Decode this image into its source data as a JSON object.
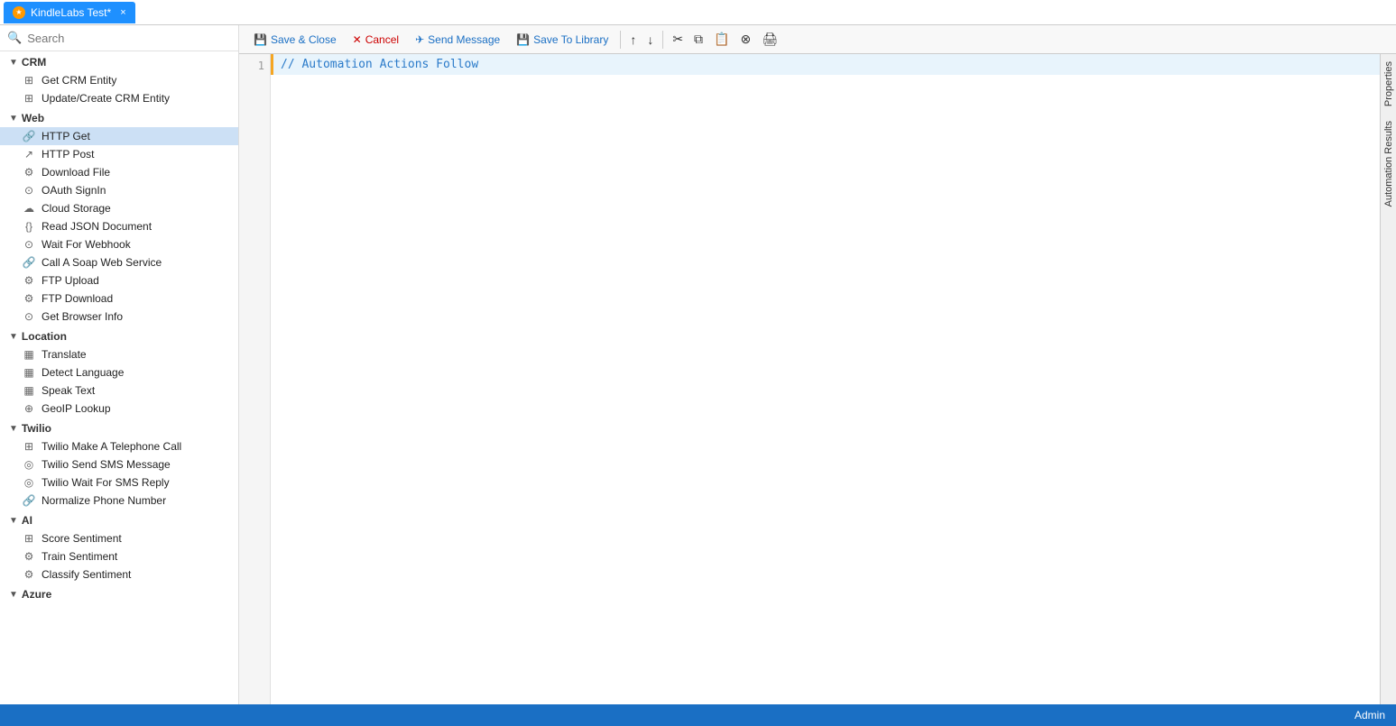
{
  "titleBar": {
    "tabLabel": "KindleLabs Test*",
    "tabIcon": "★",
    "closeLabel": "×"
  },
  "search": {
    "placeholder": "Search"
  },
  "sidebar": {
    "sections": [
      {
        "id": "crm",
        "label": "CRM",
        "items": [
          {
            "id": "get-crm-entity",
            "label": "Get CRM Entity",
            "icon": "⊞"
          },
          {
            "id": "update-create-crm-entity",
            "label": "Update/Create CRM Entity",
            "icon": "⊞"
          }
        ]
      },
      {
        "id": "web",
        "label": "Web",
        "items": [
          {
            "id": "http-get",
            "label": "HTTP Get",
            "icon": "🔗",
            "active": true
          },
          {
            "id": "http-post",
            "label": "HTTP Post",
            "icon": "↗"
          },
          {
            "id": "download-file",
            "label": "Download File",
            "icon": "⚙"
          },
          {
            "id": "oauth-signin",
            "label": "OAuth SignIn",
            "icon": "⊙"
          },
          {
            "id": "cloud-storage",
            "label": "Cloud Storage",
            "icon": "☁"
          },
          {
            "id": "read-json-document",
            "label": "Read JSON Document",
            "icon": "{}"
          },
          {
            "id": "wait-for-webhook",
            "label": "Wait For Webhook",
            "icon": "⊙"
          },
          {
            "id": "call-soap-web-service",
            "label": "Call A Soap Web Service",
            "icon": "🔗"
          },
          {
            "id": "ftp-upload",
            "label": "FTP Upload",
            "icon": "⚙"
          },
          {
            "id": "ftp-download",
            "label": "FTP Download",
            "icon": "⚙"
          },
          {
            "id": "get-browser-info",
            "label": "Get Browser Info",
            "icon": "⊙"
          }
        ]
      },
      {
        "id": "location",
        "label": "Location",
        "items": [
          {
            "id": "translate",
            "label": "Translate",
            "icon": "▦"
          },
          {
            "id": "detect-language",
            "label": "Detect Language",
            "icon": "▦"
          },
          {
            "id": "speak-text",
            "label": "Speak Text",
            "icon": "▦"
          },
          {
            "id": "geoip-lookup",
            "label": "GeoIP Lookup",
            "icon": "⊕"
          }
        ]
      },
      {
        "id": "twilio",
        "label": "Twilio",
        "items": [
          {
            "id": "twilio-call",
            "label": "Twilio Make A Telephone Call",
            "icon": "⊞"
          },
          {
            "id": "twilio-sms",
            "label": "Twilio Send SMS Message",
            "icon": "◎"
          },
          {
            "id": "twilio-wait-sms",
            "label": "Twilio Wait For SMS Reply",
            "icon": "◎"
          },
          {
            "id": "normalize-phone",
            "label": "Normalize Phone Number",
            "icon": "🔗"
          }
        ]
      },
      {
        "id": "ai",
        "label": "AI",
        "items": [
          {
            "id": "score-sentiment",
            "label": "Score Sentiment",
            "icon": "⊞"
          },
          {
            "id": "train-sentiment",
            "label": "Train Sentiment",
            "icon": "⚙"
          },
          {
            "id": "classify-sentiment",
            "label": "Classify Sentiment",
            "icon": "⚙"
          }
        ]
      },
      {
        "id": "azure",
        "label": "Azure",
        "items": []
      }
    ]
  },
  "toolbar": {
    "saveClose": "Save & Close",
    "cancel": "Cancel",
    "sendMessage": "Send Message",
    "saveToLibrary": "Save To Library"
  },
  "editor": {
    "lineNumber": "1",
    "lineContent": "// Automation Actions Follow"
  },
  "rightPanel": {
    "tab1": "Properties",
    "tab2": "Automation Results"
  },
  "footer": {
    "user": "Admin"
  }
}
